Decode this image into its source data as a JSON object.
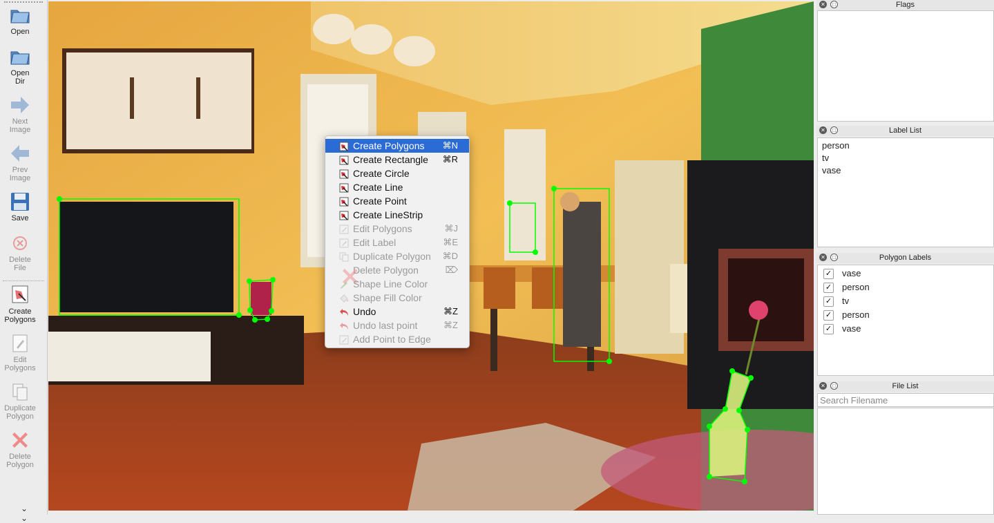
{
  "toolbar": {
    "items": [
      {
        "label": "Open",
        "icon": "folder-icon",
        "enabled": true
      },
      {
        "label": "Open\nDir",
        "icon": "folder-icon",
        "enabled": true
      },
      {
        "label": "Next\nImage",
        "icon": "arrow-right-icon",
        "enabled": false
      },
      {
        "label": "Prev\nImage",
        "icon": "arrow-left-icon",
        "enabled": false
      },
      {
        "label": "Save",
        "icon": "floppy-disk-icon",
        "enabled": true
      },
      {
        "label": "Delete\nFile",
        "icon": "delete-circle-icon",
        "enabled": false
      },
      {
        "label": "Create\nPolygons",
        "icon": "draw-polygon-icon",
        "enabled": true
      },
      {
        "label": "Edit\nPolygons",
        "icon": "edit-polygon-icon",
        "enabled": false
      },
      {
        "label": "Duplicate\nPolygon",
        "icon": "duplicate-icon",
        "enabled": false
      },
      {
        "label": "Delete\nPolygon",
        "icon": "red-x-icon",
        "enabled": false
      }
    ],
    "more_icon": "double-chevron-down-icon"
  },
  "context_menu": {
    "items": [
      {
        "label": "Create Polygons",
        "shortcut": "⌘N",
        "enabled": true,
        "selected": true,
        "icon": "draw-icon"
      },
      {
        "label": "Create Rectangle",
        "shortcut": "⌘R",
        "enabled": true,
        "icon": "draw-icon"
      },
      {
        "label": "Create Circle",
        "shortcut": "",
        "enabled": true,
        "icon": "draw-icon"
      },
      {
        "label": "Create Line",
        "shortcut": "",
        "enabled": true,
        "icon": "draw-icon"
      },
      {
        "label": "Create Point",
        "shortcut": "",
        "enabled": true,
        "icon": "draw-icon"
      },
      {
        "label": "Create LineStrip",
        "shortcut": "",
        "enabled": true,
        "icon": "draw-icon"
      },
      {
        "label": "Edit Polygons",
        "shortcut": "⌘J",
        "enabled": false,
        "icon": "edit-icon"
      },
      {
        "label": "Edit Label",
        "shortcut": "⌘E",
        "enabled": false,
        "icon": "edit-icon"
      },
      {
        "label": "Duplicate Polygon",
        "shortcut": "⌘D",
        "enabled": false,
        "icon": "copy-icon"
      },
      {
        "label": "Delete Polygon",
        "shortcut": "⌦",
        "enabled": false,
        "icon": "red-x-icon"
      },
      {
        "label": "Shape Line Color",
        "shortcut": "",
        "enabled": false,
        "icon": "pen-color-icon"
      },
      {
        "label": "Shape Fill Color",
        "shortcut": "",
        "enabled": false,
        "icon": "fill-color-icon"
      },
      {
        "label": "Undo",
        "shortcut": "⌘Z",
        "enabled": true,
        "icon": "undo-icon"
      },
      {
        "label": "Undo last point",
        "shortcut": "⌘Z",
        "enabled": false,
        "icon": "undo-icon"
      },
      {
        "label": "Add Point to Edge",
        "shortcut": "",
        "enabled": false,
        "icon": "edit-icon"
      }
    ]
  },
  "docks": {
    "flags": {
      "title": "Flags"
    },
    "label_list": {
      "title": "Label List",
      "items": [
        "person",
        "tv",
        "vase"
      ]
    },
    "polygon_labels": {
      "title": "Polygon Labels",
      "items": [
        {
          "label": "vase",
          "checked": true
        },
        {
          "label": "person",
          "checked": true
        },
        {
          "label": "tv",
          "checked": true
        },
        {
          "label": "person",
          "checked": true
        },
        {
          "label": "vase",
          "checked": true
        }
      ]
    },
    "file_list": {
      "title": "File List",
      "search_placeholder": "Search Filename"
    }
  },
  "colors": {
    "annotation_outline": "#00ff00",
    "menu_highlight": "#2b6bd6",
    "disabled_text": "#9a9a9a"
  }
}
